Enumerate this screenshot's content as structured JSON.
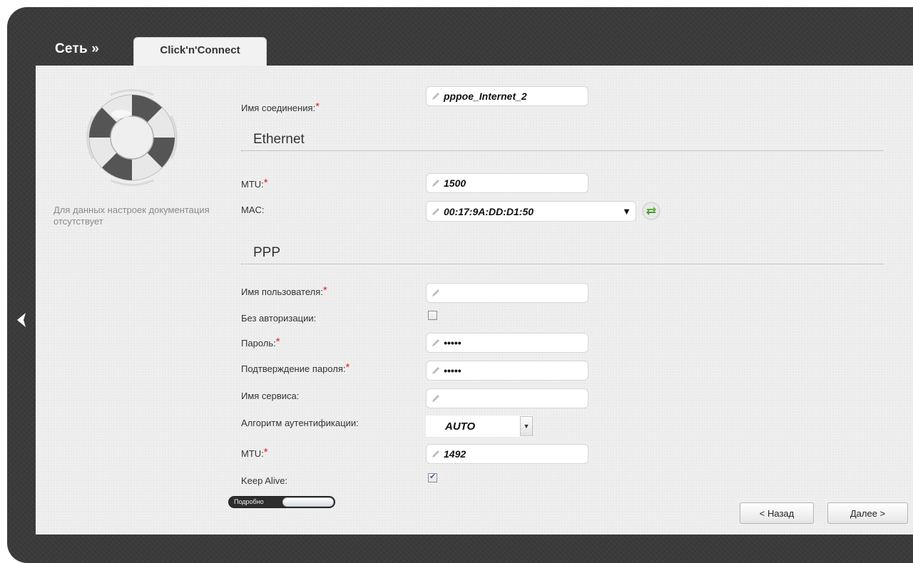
{
  "header": {
    "breadcrumb_root": "Сеть »",
    "tab_label": "Click'n'Connect"
  },
  "help": {
    "text": "Для данных настроек документация отсутствует"
  },
  "form": {
    "connection_name": {
      "label": "Имя соединения:",
      "value": "pppoe_Internet_2",
      "required": true
    },
    "ethernet": {
      "title": "Ethernet",
      "mtu": {
        "label": "MTU:",
        "value": "1500",
        "required": true
      },
      "mac": {
        "label": "MAC:",
        "value": "00:17:9A:DD:D1:50"
      }
    },
    "ppp": {
      "title": "PPP",
      "username": {
        "label": "Имя пользователя:",
        "value": "",
        "required": true
      },
      "no_auth": {
        "label": "Без авторизации:",
        "checked": false
      },
      "password": {
        "label": "Пароль:",
        "value": "•••••",
        "required": true
      },
      "password_confirm": {
        "label": "Подтверждение пароля:",
        "value": "•••••",
        "required": true
      },
      "service_name": {
        "label": "Имя сервиса:",
        "value": ""
      },
      "auth_algorithm": {
        "label": "Алгоритм аутентификации:",
        "value": "AUTO"
      },
      "mtu": {
        "label": "MTU:",
        "value": "1492",
        "required": true
      },
      "keep_alive": {
        "label": "Keep Alive:",
        "checked": true
      }
    },
    "required_mark": "*"
  },
  "toggle": {
    "label": "Подробно"
  },
  "buttons": {
    "back": "< Назад",
    "next": "Далее >"
  },
  "colors": {
    "frame": "#3a3a3a",
    "panel": "#efefef",
    "required": "#e02020",
    "refresh": "#5fae3a"
  }
}
